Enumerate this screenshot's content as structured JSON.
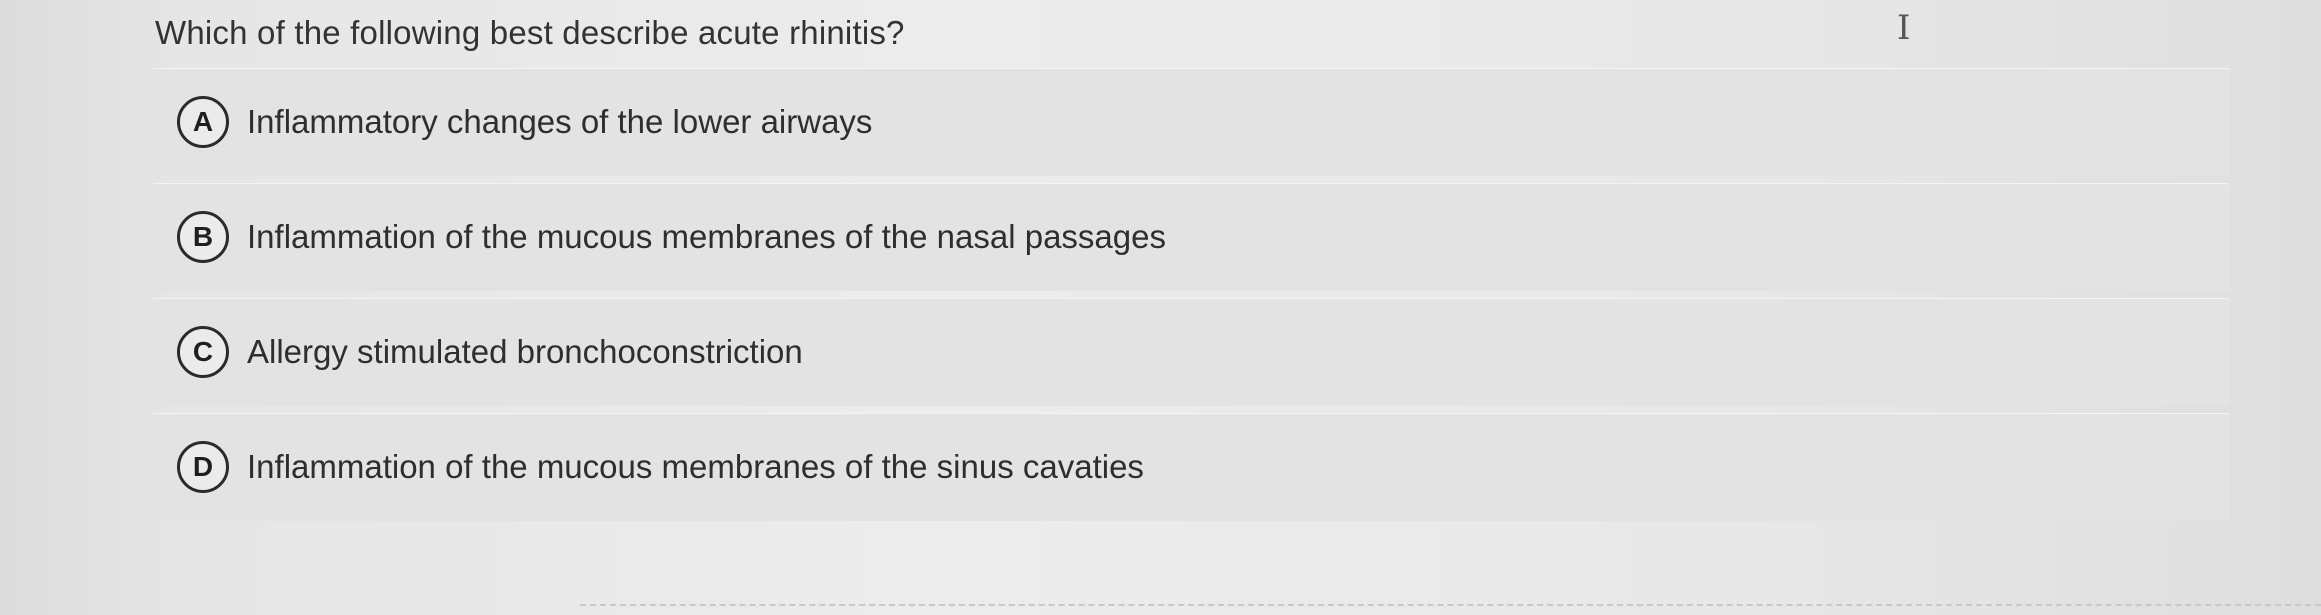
{
  "question": {
    "text": "Which of the following best describe acute rhinitis?"
  },
  "cursor_glyph": "I",
  "options": [
    {
      "letter": "A",
      "label": "Inflammatory changes of the lower airways"
    },
    {
      "letter": "B",
      "label": "Inflammation of the mucous membranes of the nasal passages"
    },
    {
      "letter": "C",
      "label": "Allergy stimulated bronchoconstriction"
    },
    {
      "letter": "D",
      "label": "Inflammation of the mucous membranes of the sinus cavaties"
    }
  ],
  "colors": {
    "option_background": "#e3e3e3",
    "text": "#2e2e2e",
    "letter_border": "#2a2a2a"
  }
}
